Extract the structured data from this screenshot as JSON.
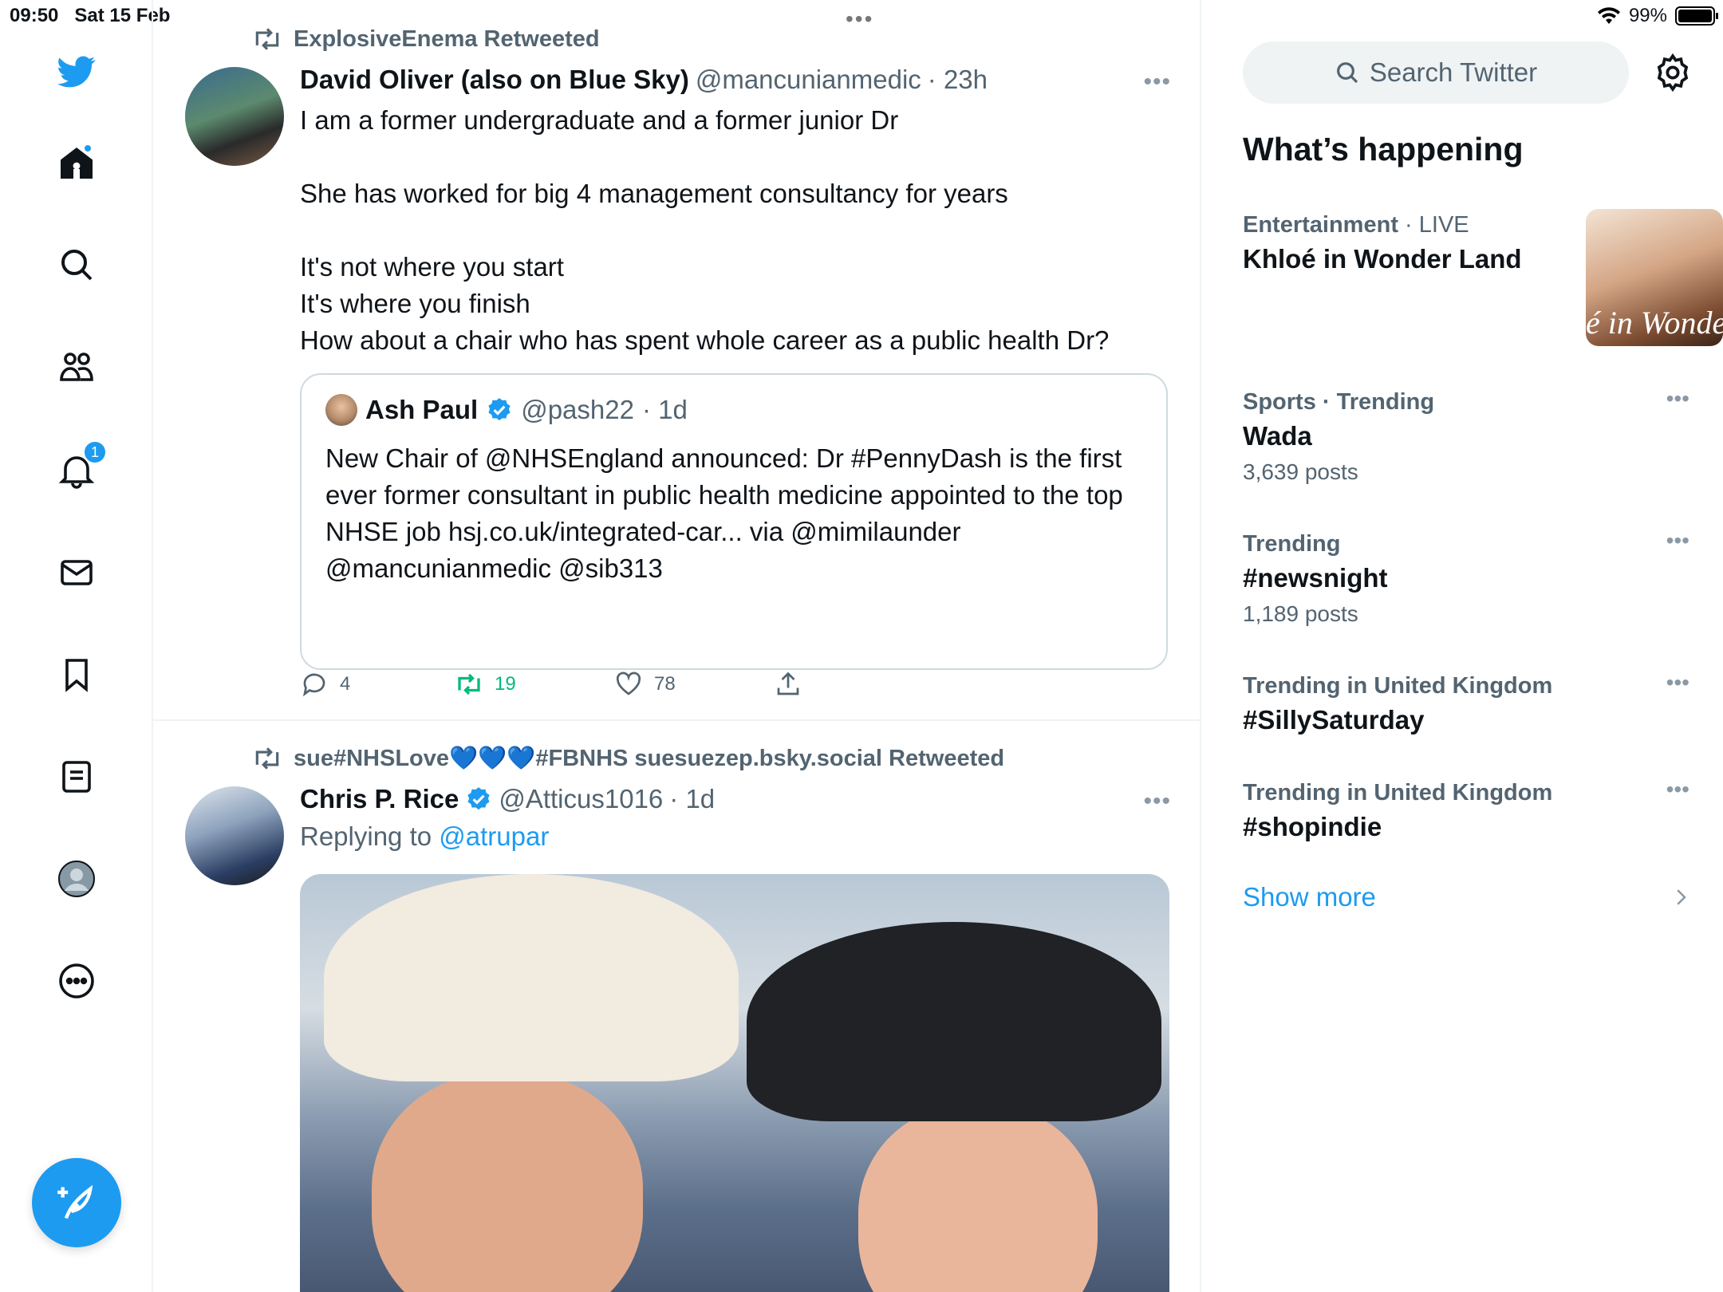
{
  "status": {
    "time": "09:50",
    "date": "Sat 15 Feb",
    "battery": "99%",
    "battery_level": 0.99
  },
  "nav": {
    "notification_count": "1"
  },
  "tweets": [
    {
      "retweeted_by": "ExplosiveEnema Retweeted",
      "name": "David Oliver (also on Blue Sky)",
      "handle": "@mancunianmedic",
      "time": "· 23h",
      "text": "I am a former undergraduate and a former junior Dr\n\nShe has worked for big 4 management consultancy for years\n\nIt's not where you start\nIt's where you finish\nHow about a chair who has spent whole career as a public health Dr?",
      "quote": {
        "name": "Ash Paul",
        "handle": "@pash22",
        "time": "· 1d",
        "text": "New Chair of @NHSEngland announced: Dr #PennyDash is the first ever former consultant in public health medicine appointed to the top NHSE job hsj.co.uk/integrated-car... via @mimilaunder @mancunianmedic @sib313"
      },
      "replies": "4",
      "retweets": "19",
      "likes": "78"
    },
    {
      "retweeted_by_prefix": "sue#NHSLove",
      "retweeted_by_suffix": "#FBNHS suesuezep.bsky.social Retweeted",
      "hearts": "💙💙💙",
      "name": "Chris P. Rice",
      "handle": "@Atticus1016",
      "time": "· 1d",
      "replying_label": "Replying to",
      "replying_to": "@atrupar"
    }
  ],
  "sidebar": {
    "search_placeholder": "Search Twitter",
    "whats_happening": "What’s happening",
    "trends": [
      {
        "category": "Entertainment",
        "sep": " · ",
        "status": "LIVE",
        "name": "Khloé in Wonder Land",
        "image_text": "é in Wonder L"
      },
      {
        "category": "Sports · Trending",
        "name": "Wada",
        "count": "3,639 posts"
      },
      {
        "category": "Trending",
        "name": "#newsnight",
        "count": "1,189 posts"
      },
      {
        "category": "Trending in United Kingdom",
        "name": "#SillySaturday"
      },
      {
        "category": "Trending in United Kingdom",
        "name": "#shopindie"
      }
    ],
    "show_more": "Show more"
  }
}
